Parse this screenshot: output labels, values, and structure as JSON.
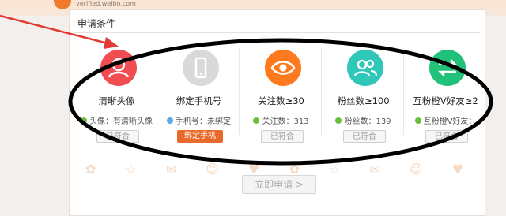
{
  "header": {
    "url": "verified.weibo.com"
  },
  "panel": {
    "title": "申请条件"
  },
  "cards": [
    {
      "title": "清晰头像",
      "status": "头像：有清晰头像",
      "status_color": "#6bbf3a",
      "button": "已符合",
      "icon": "avatar-person-icon",
      "color": "#ef4d52",
      "button_type": "done"
    },
    {
      "title": "绑定手机号",
      "status": "手机号：未绑定",
      "status_color": "#5aa9e6",
      "button": "绑定手机",
      "icon": "mobile-phone-icon",
      "color": "#d9d9d9",
      "button_type": "bind"
    },
    {
      "title": "关注数≥30",
      "status": "关注数：313",
      "status_color": "#6bbf3a",
      "button": "已符合",
      "icon": "eye-icon",
      "color": "#ff7a1f",
      "button_type": "done"
    },
    {
      "title": "粉丝数≥100",
      "status": "粉丝数：139",
      "status_color": "#6bbf3a",
      "button": "已符合",
      "icon": "followers-group-icon",
      "color": "#2fc7b7",
      "button_type": "done"
    },
    {
      "title": "互粉橙V好友≥2",
      "status": "互粉橙V好友：",
      "status_color": "#6bbf3a",
      "button": "已符合",
      "icon": "mutual-follow-icon",
      "color": "#22c17a",
      "button_type": "done"
    }
  ],
  "apply_button": {
    "label": "立即申请 >"
  },
  "colors": {
    "annotation_arrow": "#e23a35",
    "annotation_ellipse": "#000000",
    "accent": "#ea6a2b"
  }
}
